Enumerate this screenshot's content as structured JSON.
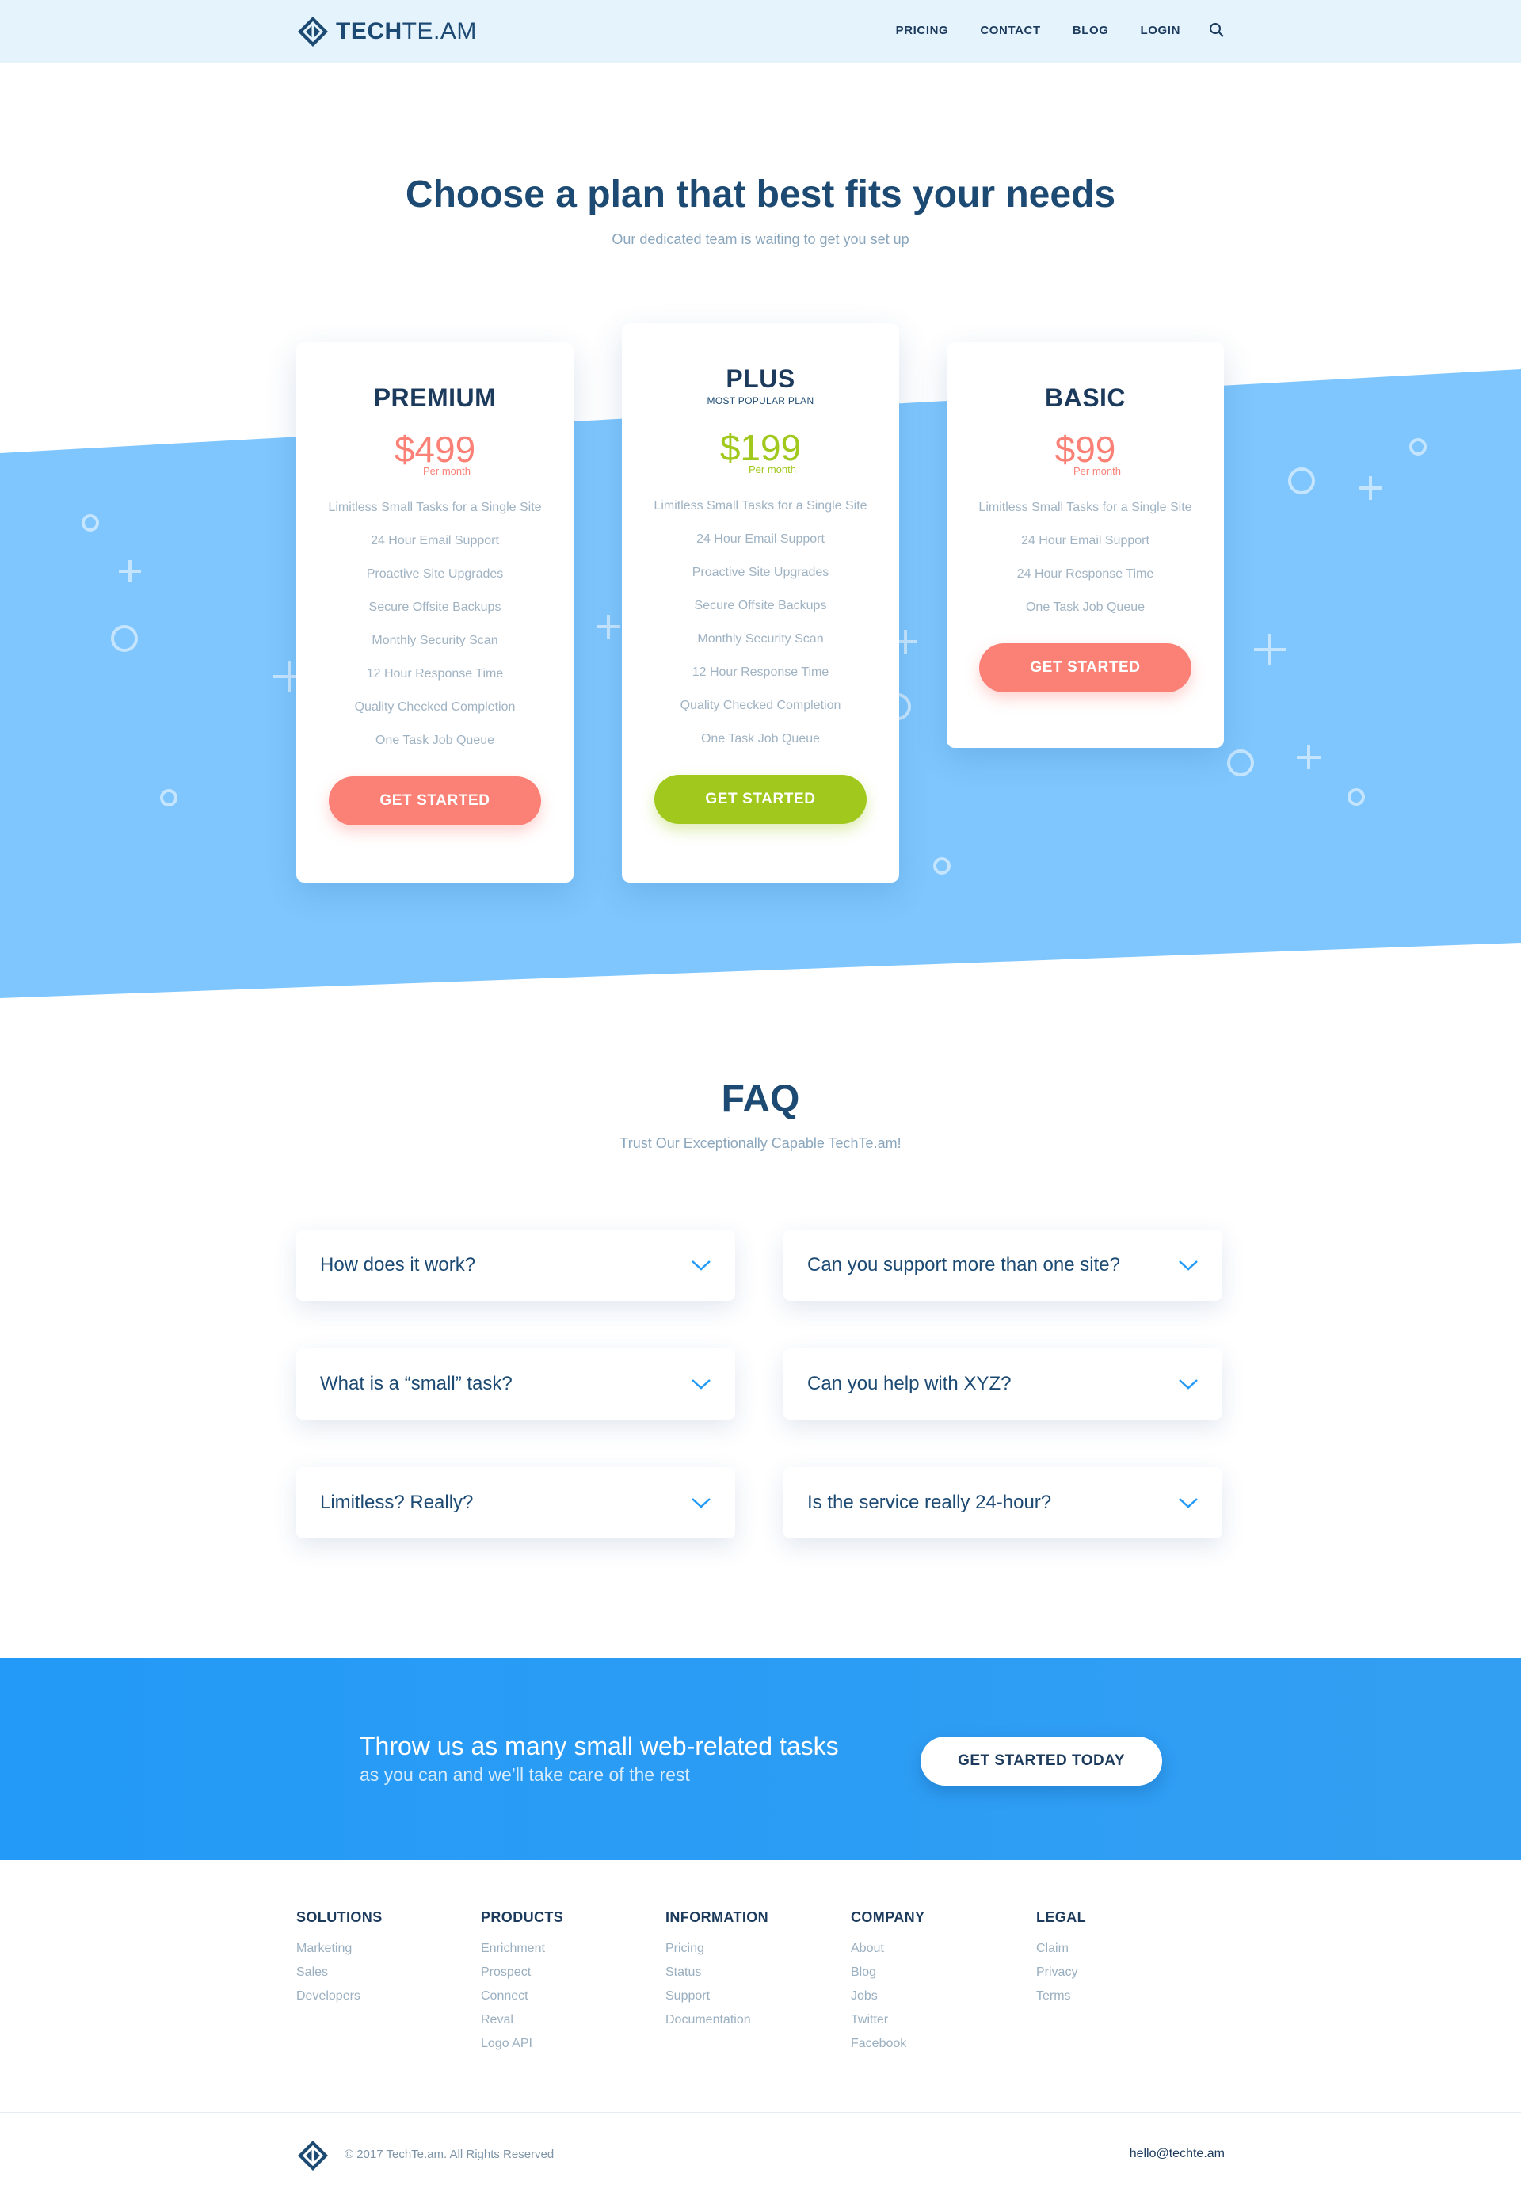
{
  "brand": {
    "name_bold": "TECH",
    "name_rest": "TE.AM"
  },
  "nav": {
    "pricing": "PRICING",
    "contact": "CONTACT",
    "blog": "BLOG",
    "login": "LOGIN"
  },
  "hero": {
    "title": "Choose a plan that best fits your needs",
    "subtitle": "Our dedicated team is waiting to get you set up"
  },
  "plans": [
    {
      "name": "PREMIUM",
      "tag": "",
      "price": "$499",
      "period": "Per month",
      "color": "#fb8177",
      "features": [
        "Limitless Small Tasks for a Single Site",
        "24 Hour Email Support",
        "Proactive Site Upgrades",
        "Secure Offsite Backups",
        "Monthly Security Scan",
        "12 Hour Response Time",
        "Quality Checked Completion",
        "One Task Job Queue"
      ],
      "cta": "GET STARTED"
    },
    {
      "name": "PLUS",
      "tag": "MOST POPULAR PLAN",
      "price": "$199",
      "period": "Per month",
      "color": "#a1c81d",
      "features": [
        "Limitless Small Tasks for a Single Site",
        "24 Hour Email Support",
        "Proactive Site Upgrades",
        "Secure Offsite Backups",
        "Monthly Security Scan",
        "12 Hour Response Time",
        "Quality Checked Completion",
        "One Task Job Queue"
      ],
      "cta": "GET STARTED"
    },
    {
      "name": "BASIC",
      "tag": "",
      "price": "$99",
      "period": "Per month",
      "color": "#fb8177",
      "features": [
        "Limitless Small Tasks for a Single Site",
        "24 Hour Email Support",
        "24 Hour Response Time",
        "One Task Job Queue"
      ],
      "cta": "GET STARTED"
    }
  ],
  "faq": {
    "title": "FAQ",
    "subtitle": "Trust Our Exceptionally Capable TechTe.am!",
    "items": [
      "How does it work?",
      "Can you support more than one site?",
      "What is a “small” task?",
      "Can you help with XYZ?",
      "Limitless? Really?",
      "Is the service really 24-hour?"
    ]
  },
  "cta": {
    "title": "Throw us as many small web-related tasks",
    "subtitle": "as you can and we’ll take care of the rest",
    "button": "GET STARTED TODAY"
  },
  "footer": {
    "columns": [
      {
        "title": "SOLUTIONS",
        "links": [
          "Marketing",
          "Sales",
          "Developers"
        ]
      },
      {
        "title": "PRODUCTS",
        "links": [
          "Enrichment",
          "Prospect",
          "Connect",
          "Reval",
          "Logo API"
        ]
      },
      {
        "title": "INFORMATION",
        "links": [
          "Pricing",
          "Status",
          "Support",
          "Documentation"
        ]
      },
      {
        "title": "COMPANY",
        "links": [
          "About",
          "Blog",
          "Jobs",
          "Twitter",
          "Facebook"
        ]
      },
      {
        "title": "LEGAL",
        "links": [
          "Claim",
          "Privacy",
          "Terms"
        ]
      }
    ],
    "copyright": "© 2017 TechTe.am. All Rights Reserved",
    "email": "hello@techte.am"
  },
  "colors": {
    "accent_blue": "#239af7",
    "band_blue": "#7ec6fd",
    "navy": "#1c4a73",
    "coral": "#fb8177",
    "green": "#a1c81d"
  },
  "icons": {
    "search": "search-icon",
    "chevron": "chevron-down-icon",
    "logo": "techteam-logo-icon"
  }
}
